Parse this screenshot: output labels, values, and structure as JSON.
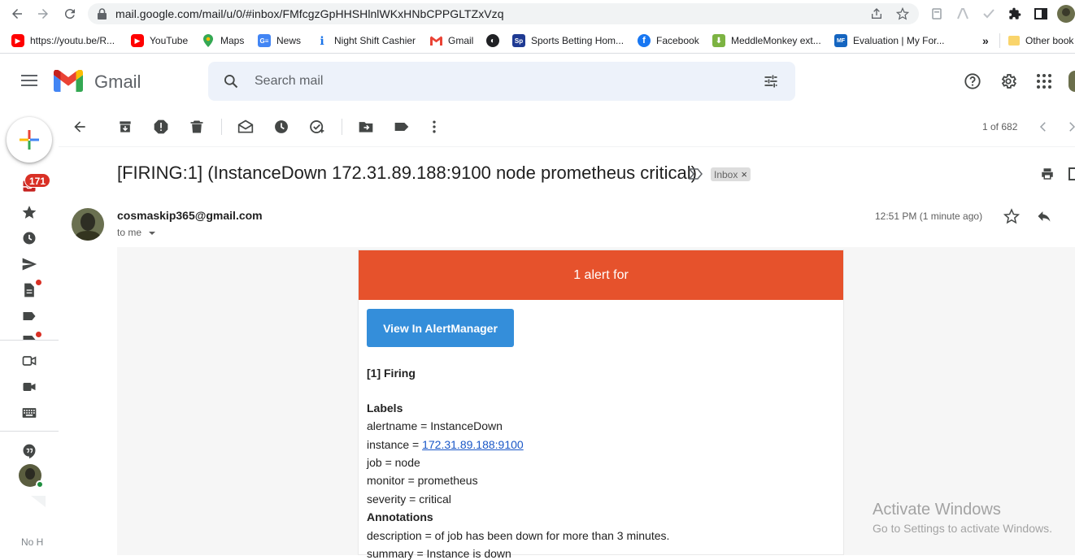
{
  "browser": {
    "url": "mail.google.com/mail/u/0/#inbox/FMfcgzGpHHSHlnlWKxHNbCPPGLTZxVzq",
    "bookmarks": [
      {
        "label": "https://youtu.be/R...",
        "icon": "youtube-icon"
      },
      {
        "label": "YouTube",
        "icon": "youtube-icon"
      },
      {
        "label": "Maps",
        "icon": "maps-pin-icon"
      },
      {
        "label": "News",
        "icon": "news-icon"
      },
      {
        "label": "Night Shift Cashier",
        "icon": "info-icon"
      },
      {
        "label": "Gmail",
        "icon": "gmail-icon"
      },
      {
        "label": "",
        "icon": "globe-icon"
      },
      {
        "label": "Sports Betting Hom...",
        "icon": "sp-icon"
      },
      {
        "label": "Facebook",
        "icon": "facebook-icon"
      },
      {
        "label": "MeddleMonkey ext...",
        "icon": "download-icon"
      },
      {
        "label": "Evaluation | My For...",
        "icon": "mf-icon"
      }
    ],
    "more_label": "»",
    "other_bookmarks": "Other book"
  },
  "gmail": {
    "brand": "Gmail",
    "search_placeholder": "Search mail",
    "unread_count": "171",
    "rail_bottom_label": "No H"
  },
  "toolbar": {
    "pagination": "1 of 682"
  },
  "message": {
    "subject": "[FIRING:1] (InstanceDown 172.31.89.188:9100 node prometheus critical)",
    "label_chip": "Inbox",
    "label_chip_close": "×",
    "sender": "cosmaskip365@gmail.com",
    "recipient": "to me",
    "time": "12:51 PM (1 minute ago)"
  },
  "email_body": {
    "banner": "1 alert for",
    "button": "View In AlertManager",
    "firing": "[1] Firing",
    "labels_heading": "Labels",
    "alertname": "alertname = InstanceDown",
    "instance_prefix": "instance = ",
    "instance_link": "172.31.89.188:9100",
    "job": "job = node",
    "monitor": "monitor = prometheus",
    "severity": "severity = critical",
    "annotations_heading": "Annotations",
    "description": "description = of job has been down for more than 3 minutes.",
    "summary": "summary = Instance is down"
  },
  "watermark": {
    "title": "Activate Windows",
    "subtitle": "Go to Settings to activate Windows."
  },
  "colors": {
    "alert_banner": "#e6522c",
    "button": "#348eda",
    "badge": "#d93025"
  }
}
